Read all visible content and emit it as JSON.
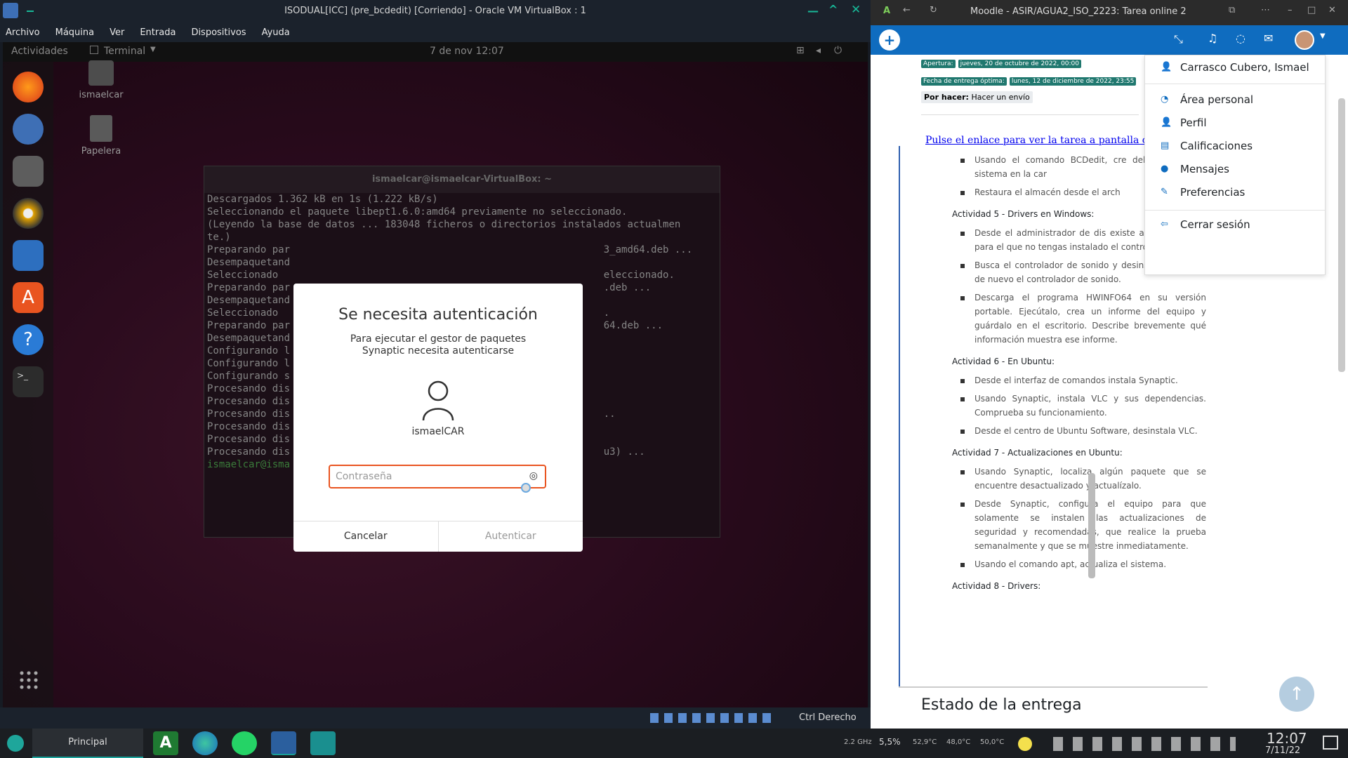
{
  "vbox": {
    "title": "ISODUAL[ICC] (pre_bcdedit) [Corriendo] - Oracle VM VirtualBox : 1",
    "menu": [
      "Archivo",
      "Máquina",
      "Ver",
      "Entrada",
      "Dispositivos",
      "Ayuda"
    ],
    "status_text": "Ctrl Derecho"
  },
  "guest": {
    "activities": "Actividades",
    "app_menu": "Terminal",
    "clock": "7 de nov  12:07",
    "desktop_icons": [
      "ismaelcar",
      "Papelera"
    ],
    "terminal_title": "ismaelcar@ismaelcar-VirtualBox: ~",
    "terminal_lines": [
      "Descargados 1.362 kB en 1s (1.222 kB/s)",
      "Seleccionando el paquete libept1.6.0:amd64 previamente no seleccionado.",
      "(Leyendo la base de datos ... 183048 ficheros o directorios instalados actualmen",
      "te.)",
      "Preparando par                                                     3_amd64.deb ...",
      "Desempaquetand",
      "Seleccionado                                                       eleccionado.",
      "Preparando par                                                     .deb ...",
      "Desempaquetand",
      "Seleccionado                                                       .",
      "Preparando par                                                     64.deb ...",
      "Desempaquetand",
      "Configurando l",
      "Configurando l",
      "Configurando s",
      "Procesando dis",
      "Procesando dis",
      "Procesando dis                                                     ..",
      "Procesando dis",
      "Procesando dis",
      "Procesando dis                                                     u3) ..."
    ],
    "terminal_prompt": "ismaelcar@isma",
    "dialog": {
      "title": "Se necesita autenticación",
      "subtitle": "Para ejecutar el gestor de paquetes Synaptic necesita autenticarse",
      "username": "ismaelCAR",
      "password_placeholder": "Contraseña",
      "cancel": "Cancelar",
      "authenticate": "Autenticar"
    }
  },
  "edge": {
    "tab_title": "Moodle - ASIR/AGUA2_ISO_2223: Tarea online 2",
    "dates": [
      {
        "label": "Apertura:",
        "value": "jueves, 20 de octubre de 2022, 00:00"
      },
      {
        "label": "Fecha de entrega óptima:",
        "value": "lunes, 12 de diciembre de 2022, 23:55"
      }
    ],
    "todo_label": "Por hacer:",
    "todo_value": "Hacer un envío",
    "link_text": "Pulse el enlace para ver la tarea a pantalla compl",
    "intro_items": [
      "Usando el comando BCDedit, cre del almacén del sistema en la car",
      "Restaura el almacén desde el arch"
    ],
    "activities": [
      {
        "heading": "Actividad 5 - Drivers en Windows:",
        "items": [
          "Desde el administrador de dis existe algún hardware para el que no tengas instalado el controlador.",
          "Busca el controlador de sonido y desinstálalo.  Instala de nuevo el controlador de sonido.",
          "Descarga el programa HWINFO64 en su versión portable.  Ejecútalo, crea un informe del equipo y guárdalo en el escritorio.  Describe brevemente qué información muestra ese informe."
        ]
      },
      {
        "heading": "Actividad 6 - En Ubuntu:",
        "items": [
          "Desde el interfaz de comandos instala Synaptic.",
          "Usando Synaptic, instala VLC y sus dependencias. Comprueba su funcionamiento.",
          "Desde el centro de Ubuntu Software, desinstala VLC."
        ]
      },
      {
        "heading": "Actividad 7 - Actualizaciones en Ubuntu:",
        "items": [
          "Usando Synaptic, localiza algún paquete que se encuentre desactualizado y actualízalo.",
          "Desde Synaptic, configura el equipo para que solamente se instalen las actualizaciones de seguridad y recomendadas, que realice la prueba semanalmente y que se muestre inmediatamente.",
          "Usando el comando apt, actualiza el sistema."
        ]
      },
      {
        "heading": "Actividad 8 - Drivers:",
        "items": []
      }
    ],
    "section_title": "Estado de la entrega",
    "user_menu": {
      "name": "Carrasco Cubero, Ismael",
      "items": [
        "Área personal",
        "Perfil",
        "Calificaciones",
        "Mensajes",
        "Preferencias"
      ],
      "logout": "Cerrar sesión"
    }
  },
  "taskbar": {
    "start_label": "Principal",
    "cpu_freq": "2.2 GHz",
    "cpu_usage": "5,5%",
    "temps": [
      "52,9°C",
      "48,0°C",
      "50,0°C"
    ],
    "time": "12:07",
    "date": "7/11/22"
  }
}
